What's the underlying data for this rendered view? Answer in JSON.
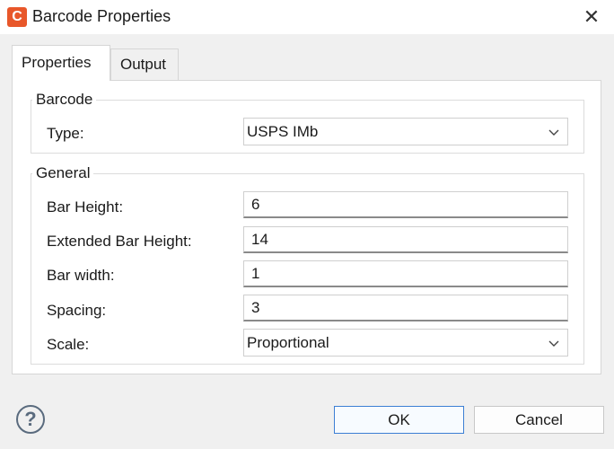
{
  "window": {
    "title": "Barcode Properties",
    "app_icon_letter": "C",
    "close_glyph": "✕"
  },
  "tabs": [
    {
      "label": "Properties",
      "active": true
    },
    {
      "label": "Output",
      "active": false
    }
  ],
  "barcode_group": {
    "title": "Barcode",
    "type_label": "Type:",
    "type_value": "USPS IMb"
  },
  "general_group": {
    "title": "General",
    "fields": [
      {
        "label": "Bar Height:",
        "value": "6"
      },
      {
        "label": "Extended Bar Height:",
        "value": "14"
      },
      {
        "label": "Bar width:",
        "value": "1"
      },
      {
        "label": "Spacing:",
        "value": "3"
      }
    ],
    "scale_label": "Scale:",
    "scale_value": "Proportional"
  },
  "footer": {
    "help_glyph": "?",
    "ok_label": "OK",
    "cancel_label": "Cancel"
  },
  "colors": {
    "accent": "#3c7fd4",
    "app_icon": "#e8572a"
  },
  "icons": {
    "app": "app-logo-icon",
    "close": "close-icon",
    "dropdown": "chevron-down-icon",
    "help": "help-icon"
  }
}
